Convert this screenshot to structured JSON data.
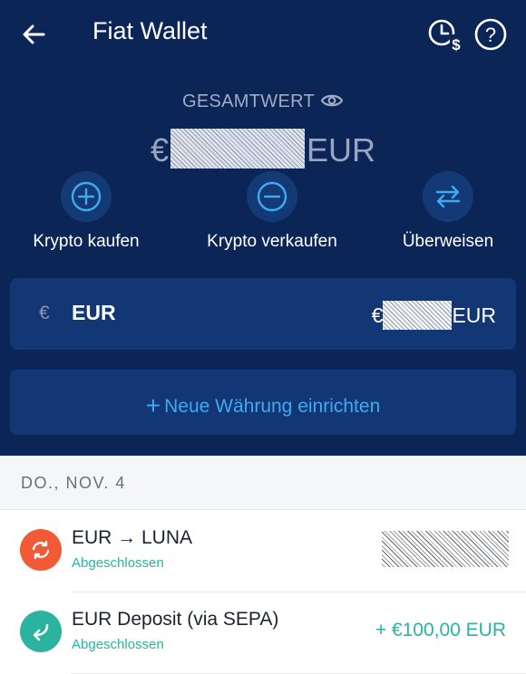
{
  "header": {
    "title": "Fiat Wallet"
  },
  "summary": {
    "label": "GESAMTWERT",
    "currency_symbol": "€",
    "currency_code": "EUR"
  },
  "actions": [
    {
      "label": "Krypto kaufen",
      "icon": "plus-circle-icon"
    },
    {
      "label": "Krypto verkaufen",
      "icon": "minus-circle-icon"
    },
    {
      "label": "Überweisen",
      "icon": "transfer-arrows-icon"
    }
  ],
  "wallet": {
    "symbol": "€",
    "name": "EUR",
    "amount_symbol": "€",
    "amount_code": "EUR"
  },
  "new_currency": {
    "plus": "+",
    "label": "Neue Währung einrichten"
  },
  "date_header": "DO., NOV. 4",
  "transactions": [
    {
      "title": "EUR → LUNA",
      "status": "Abgeschlossen",
      "icon": "exchange-icon",
      "color": "#f05a34"
    },
    {
      "title": "EUR Deposit (via SEPA)",
      "status": "Abgeschlossen",
      "amount": "+ €100,00 EUR",
      "icon": "deposit-icon",
      "color": "#2bb39f"
    }
  ],
  "colors": {
    "header_bg": "#0c2557",
    "card_bg": "#133774",
    "accent_blue": "#3eaaf0",
    "success_green": "#2bb39f",
    "exchange_orange": "#f05a34"
  }
}
